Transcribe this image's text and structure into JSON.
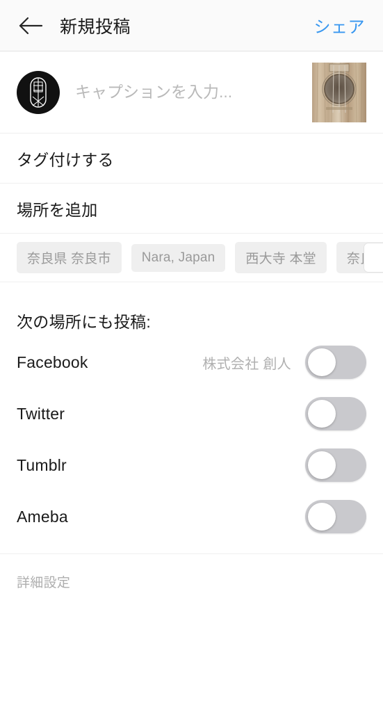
{
  "header": {
    "back_icon": "arrow-left-icon",
    "title": "新規投稿",
    "share_label": "シェア",
    "share_color": "#3897f0",
    "background": "#fafafa"
  },
  "caption": {
    "avatar_alt": "profile-avatar",
    "placeholder": "キャプションを入力...",
    "value": "",
    "thumbnail_alt": "post-thumbnail-guitar-soundhole"
  },
  "menu": {
    "tag_people_label": "タグ付けする",
    "add_location_label": "場所を追加"
  },
  "location_suggestions": {
    "chips": [
      {
        "label": "奈良県 奈良市"
      },
      {
        "label": "Nara, Japan"
      },
      {
        "label": "西大寺 本堂"
      },
      {
        "label": "奈良 世界遺産"
      }
    ],
    "chip_bg": "#efefef",
    "chip_text_color": "#9a9a9a"
  },
  "share_to": {
    "heading": "次の場所にも投稿:",
    "services": [
      {
        "name": "Facebook",
        "account": "株式会社 創人",
        "enabled": false
      },
      {
        "name": "Twitter",
        "account": "",
        "enabled": false
      },
      {
        "name": "Tumblr",
        "account": "",
        "enabled": false
      },
      {
        "name": "Ameba",
        "account": "",
        "enabled": false
      }
    ],
    "toggle_off_color": "#c9c9cd",
    "toggle_on_color": "#3897f0"
  },
  "footer": {
    "advanced_label": "詳細設定"
  }
}
